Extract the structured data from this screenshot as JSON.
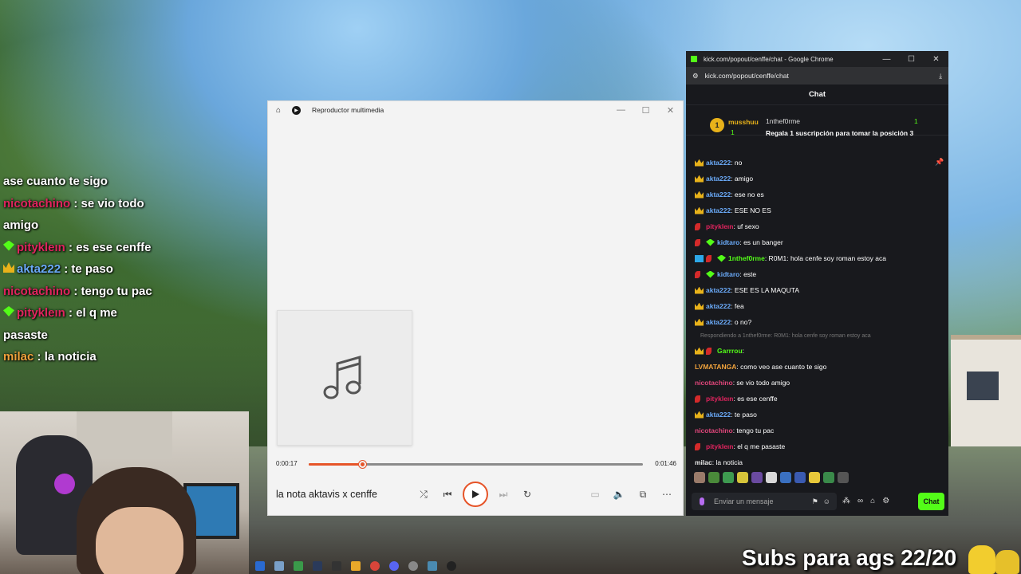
{
  "overlay_chat": [
    {
      "text": "ase cuanto te sigo",
      "name": "",
      "name_color": "#ffffff",
      "badge": ""
    },
    {
      "name": "nicotachino",
      "name_color": "#e0245e",
      "text": " : se vio todo",
      "badge": ""
    },
    {
      "text": "amigo",
      "name": "",
      "name_color": "#ffffff",
      "badge": ""
    },
    {
      "name": "pitykleın",
      "name_color": "#e0245e",
      "text": " : es ese cenffe",
      "badge": "gem"
    },
    {
      "name": "akta222",
      "name_color": "#6aa9f7",
      "text": " : te paso",
      "badge": "crown"
    },
    {
      "name": "nicotachino",
      "name_color": "#e0245e",
      "text": " : tengo tu pac",
      "badge": ""
    },
    {
      "name": "pitykleın",
      "name_color": "#e0245e",
      "text": " : el q me",
      "badge": "gem"
    },
    {
      "text": "pasaste",
      "name": "",
      "name_color": "#ffffff",
      "badge": ""
    },
    {
      "name": "milac",
      "name_color": "#f0a23c",
      "text": " : la noticia",
      "badge": ""
    }
  ],
  "player": {
    "title": "Reproductor multimedia",
    "current_time": "0:00:17",
    "total_time": "0:01:46",
    "progress": 0.16,
    "song": "la nota aktavis x cenffe",
    "accent": "#e65428"
  },
  "chrome": {
    "window_title": "kick.com/popout/cenffe/chat - Google Chrome",
    "url": "kick.com/popout/cenffe/chat"
  },
  "chat": {
    "header": "Chat",
    "pinned": {
      "rank": "1",
      "user": "musshuu",
      "user_count": "1",
      "user2": "1nthef0rme",
      "user2_count": "1",
      "message": "Regala 1 suscripción para tomar la posición 3"
    },
    "messages": [
      {
        "user": "akta222",
        "text": ": no",
        "cls": "u-akta",
        "badges": [
          "crown"
        ]
      },
      {
        "user": "akta222",
        "text": ": amigo",
        "cls": "u-akta",
        "badges": [
          "crown"
        ]
      },
      {
        "user": "akta222",
        "text": ": ese no es",
        "cls": "u-akta",
        "badges": [
          "crown"
        ]
      },
      {
        "user": "akta222",
        "text": ": ESE NO ES",
        "cls": "u-akta",
        "badges": [
          "crown"
        ]
      },
      {
        "user": "pitykleın",
        "text": ": uf sexo",
        "cls": "u-pity",
        "badges": [
          "pepper"
        ]
      },
      {
        "user": "kidtaro",
        "text": ": es un banger",
        "cls": "u-kid",
        "badges": [
          "pepper",
          "gem"
        ]
      },
      {
        "user": "1nthef0rme",
        "text": ": R0M1: hola cenfe soy roman estoy aca",
        "cls": "u-1n",
        "badges": [
          "vip",
          "pepper",
          "gem"
        ]
      },
      {
        "user": "kidtaro",
        "text": ": este",
        "cls": "u-kid",
        "badges": [
          "pepper",
          "gem"
        ]
      },
      {
        "user": "akta222",
        "text": ": ESE ES LA MAQUTA",
        "cls": "u-akta",
        "badges": [
          "crown"
        ]
      },
      {
        "user": "akta222",
        "text": ": fea",
        "cls": "u-akta",
        "badges": [
          "crown"
        ]
      },
      {
        "user": "akta222",
        "text": ": o no?",
        "cls": "u-akta",
        "badges": [
          "crown"
        ]
      }
    ],
    "reply": "Respondiendo a 1nthef0rme: R0M1: hola cenfe soy roman estoy aca",
    "messages2": [
      {
        "user": "Garrrou",
        "text": ":",
        "cls": "u-gar",
        "badges": [
          "crown",
          "pepper"
        ]
      },
      {
        "user": "LVMATANGA",
        "text": ": como veo ase cuanto te sigo",
        "cls": "u-lv",
        "badges": []
      },
      {
        "user": "nicotachino",
        "text": ": se vio todo amigo",
        "cls": "u-nico",
        "badges": []
      },
      {
        "user": "pitykleın",
        "text": ": es ese cenffe",
        "cls": "u-pity",
        "badges": [
          "pepper"
        ]
      },
      {
        "user": "akta222",
        "text": ": te paso",
        "cls": "u-akta",
        "badges": [
          "crown"
        ]
      },
      {
        "user": "nicotachino",
        "text": ": tengo tu pac",
        "cls": "u-nico",
        "badges": []
      },
      {
        "user": "pitykleın",
        "text": ": el q me pasaste",
        "cls": "u-pity",
        "badges": [
          "pepper"
        ]
      },
      {
        "user": "milac",
        "text": ": la noticia",
        "cls": "u-mil",
        "badges": []
      }
    ],
    "input_placeholder": "Enviar un mensaje",
    "send_label": "Chat"
  },
  "stream_overlay": {
    "subs_text": "Subs para ags 22/20"
  },
  "colors": {
    "kick_green": "#53fc18",
    "crown": "#e8b21a"
  }
}
